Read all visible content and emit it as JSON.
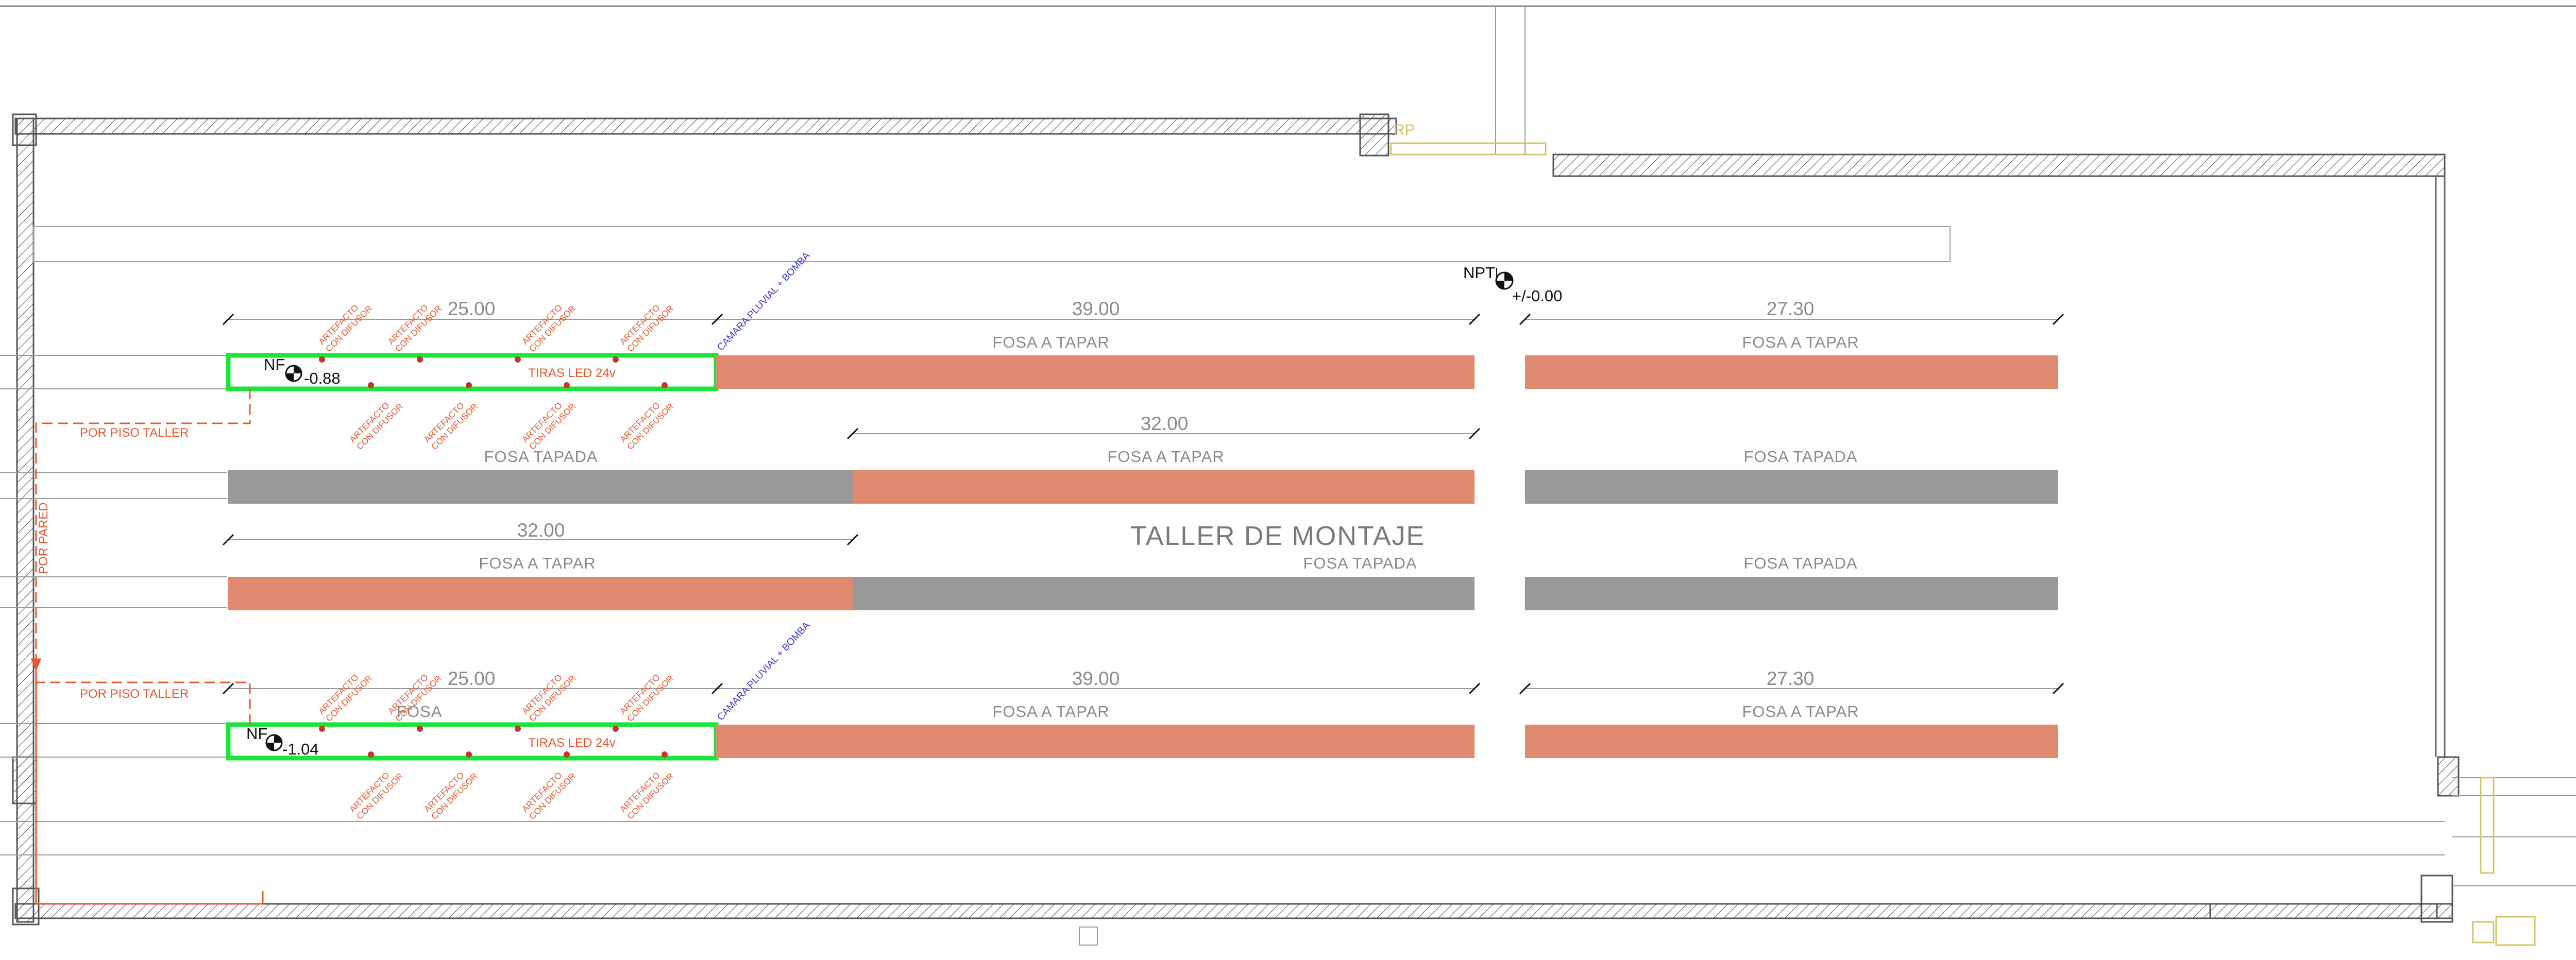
{
  "title": "TALLER DE MONTAJE",
  "level_npt": {
    "label": "NPT",
    "value": "+/-0.00"
  },
  "colors": {
    "fosa_a_tapar": "#df8a6e",
    "fosa_tapada": "#999999",
    "fosa_led": "#1ee33b",
    "wall_line": "#555555",
    "annotation_red": "#e8572e",
    "annotation_blue": "#3b3bd9"
  },
  "rows": [
    {
      "dims": [
        "25.00",
        "39.00",
        "27.30"
      ],
      "labels": [
        "FOSA  A TAPAR",
        "FOSA  A TAPAR"
      ],
      "led": {
        "level_label": "NF",
        "level_value": "-0.88",
        "tiras": "TIRAS LED 24v",
        "camara": "CAMARA PLUVIAL + BOMBA"
      }
    },
    {
      "dims": [
        "32.00"
      ],
      "labels": [
        "FOSA  TAPADA",
        "FOSA  A TAPAR",
        "FOSA  TAPADA"
      ]
    },
    {
      "dims": [
        "32.00"
      ],
      "labels": [
        "FOSA A TAPAR",
        "FOSA  TAPADA",
        "FOSA  TAPADA"
      ]
    },
    {
      "dims": [
        "25.00",
        "39.00",
        "27.30"
      ],
      "labels": [
        "FOSA A TAPAR",
        "FOSA A TAPAR"
      ],
      "led": {
        "level_label": "NF",
        "level_value": "-1.04",
        "tiras": "TIRAS LED 24v",
        "camara": "CAMARA PLUVIAL + BOMBA",
        "fosa_text": "FOSA"
      }
    }
  ],
  "artefacto": {
    "line1": "ARTEFACTO",
    "line2": "CON DIFUSOR"
  },
  "por_piso_taller": "POR PISO TALLER",
  "por_pared": "POR PARED",
  "rp_tag": "RP"
}
